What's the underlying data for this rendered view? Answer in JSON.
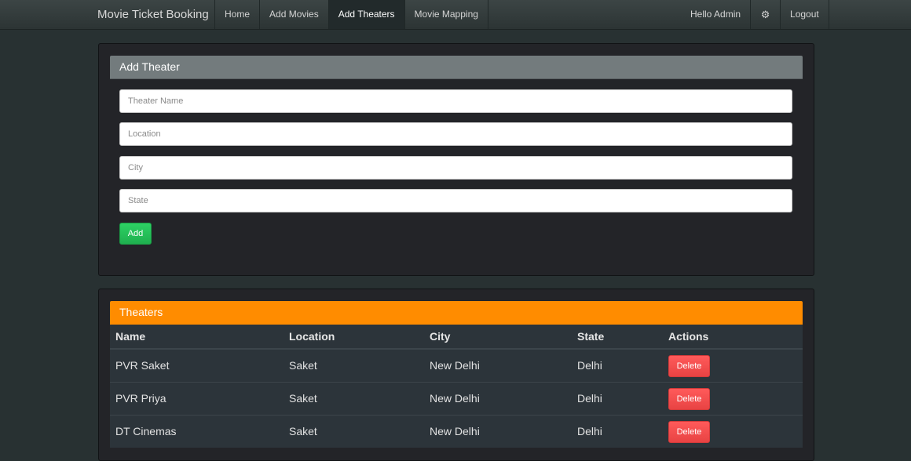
{
  "navbar": {
    "brand": "Movie Ticket Booking",
    "links": [
      "Home",
      "Add Movies",
      "Add Theaters",
      "Movie Mapping"
    ],
    "active": "Add Theaters",
    "greeting": "Hello Admin",
    "settings_icon": "gear-icon",
    "logout": "Logout"
  },
  "form": {
    "title": "Add Theater",
    "fields": {
      "name_placeholder": "Theater Name",
      "location_placeholder": "Location",
      "city_placeholder": "City",
      "state_placeholder": "State"
    },
    "add_label": "Add"
  },
  "theaters": {
    "title": "Theaters",
    "columns": [
      "Name",
      "Location",
      "City",
      "State",
      "Actions"
    ],
    "rows": [
      {
        "name": "PVR Saket",
        "location": "Saket",
        "city": "New Delhi",
        "state": "Delhi",
        "action": "Delete"
      },
      {
        "name": "PVR Priya",
        "location": "Saket",
        "city": "New Delhi",
        "state": "Delhi",
        "action": "Delete"
      },
      {
        "name": "DT Cinemas",
        "location": "Saket",
        "city": "New Delhi",
        "state": "Delhi",
        "action": "Delete"
      }
    ]
  },
  "colors": {
    "background": "#283132",
    "form_header": "#737b7d",
    "list_header": "#ff8c00",
    "add_button": "#22c35a",
    "delete_button": "#f24d4d"
  }
}
